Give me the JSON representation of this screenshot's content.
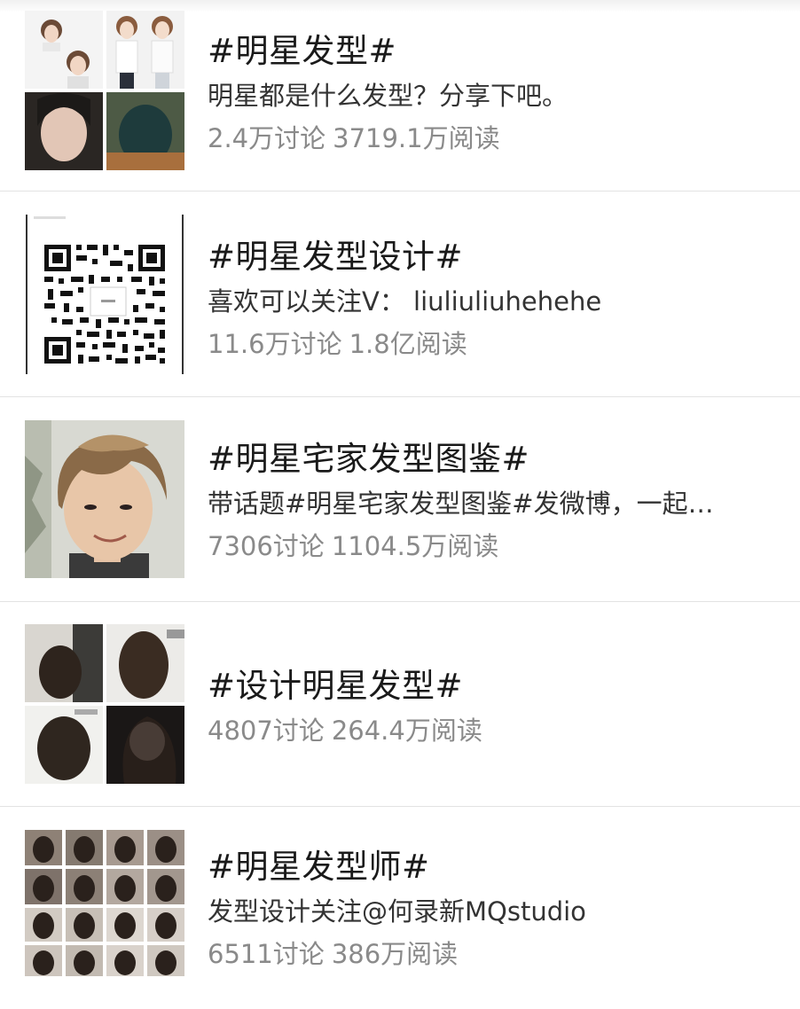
{
  "topics": [
    {
      "title": "#明星发型#",
      "description": "明星都是什么发型？分享下吧。",
      "discussions": "2.4万讨论",
      "reads": "3719.1万阅读",
      "thumbnail": "collage-2x2-portraits"
    },
    {
      "title": "#明星发型设计#",
      "description": "喜欢可以关注V： liuliuliuhehehe",
      "discussions": "11.6万讨论",
      "reads": "1.8亿阅读",
      "thumbnail": "qr-code"
    },
    {
      "title": "#明星宅家发型图鉴#",
      "description": "带话题#明星宅家发型图鉴#发微博，一起…",
      "discussions": "7306讨论",
      "reads": "1104.5万阅读",
      "thumbnail": "single-portrait"
    },
    {
      "title": "#设计明星发型#",
      "description": "",
      "discussions": "4807讨论",
      "reads": "264.4万阅读",
      "thumbnail": "collage-2x2-hair"
    },
    {
      "title": "#明星发型师#",
      "description": "发型设计关注@何录新MQstudio",
      "discussions": "6511讨论",
      "reads": "386万阅读",
      "thumbnail": "grid-hair-styles"
    }
  ]
}
